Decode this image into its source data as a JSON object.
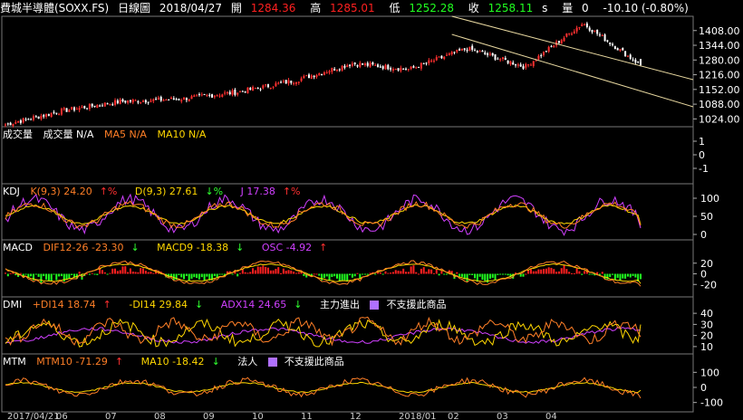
{
  "header": {
    "title": "費城半導體(SOXX.FS)",
    "period": "日線圖",
    "date": "2018/04/27",
    "open_label": "開",
    "open": "1284.36",
    "high_label": "高",
    "high": "1285.01",
    "low_label": "低",
    "low": "1252.28",
    "close_label": "收",
    "close": "1258.11",
    "unit": "s",
    "vol_label": "量",
    "vol": "0",
    "change": "-10.10 (-0.80%)"
  },
  "panes": {
    "price": {
      "ticks": [
        "1408.00",
        "1344.00",
        "1280.00",
        "1216.00",
        "1152.00",
        "1088.00",
        "1024.00"
      ]
    },
    "volume": {
      "label": "成交量",
      "vol": "成交量 N/A",
      "ma5": "MA5 N/A",
      "ma10": "MA10 N/A",
      "ticks": [
        "1",
        "0",
        "-1"
      ]
    },
    "kdj": {
      "label": "KDJ",
      "k": "K(9,3) 24.20",
      "k_arrow": "↑%",
      "d": "D(9,3) 27.61",
      "d_arrow": "↓%",
      "j": "J 17.38",
      "j_arrow": "↑%",
      "ticks": [
        "100",
        "50",
        "0"
      ]
    },
    "macd": {
      "label": "MACD",
      "dif": "DIF12-26 -23.30",
      "dif_arrow": "↓",
      "macd9": "MACD9 -18.38",
      "macd9_arrow": "↓",
      "osc": "OSC -4.92",
      "osc_arrow": "↑",
      "ticks": [
        "20",
        "0",
        "-20"
      ]
    },
    "dmi": {
      "label": "DMI",
      "pdi": "+DI14 18.74",
      "pdi_arrow": "↑",
      "mdi": "-DI14 29.84",
      "mdi_arrow": "↓",
      "adx": "ADX14 24.65",
      "adx_arrow": "↓",
      "main": "主力進出",
      "unsupported": "不支援此商品",
      "ticks": [
        "40",
        "30",
        "20",
        "10"
      ]
    },
    "mtm": {
      "label": "MTM",
      "mtm": "MTM10 -71.29",
      "mtm_arrow": "↑",
      "ma": "MA10 -18.42",
      "ma_arrow": "↓",
      "inst": "法人",
      "unsupported": "不支援此商品",
      "ticks": [
        "100",
        "0",
        "-100"
      ]
    }
  },
  "xaxis": {
    "ticks": [
      "2017/04/21",
      "06",
      "07",
      "08",
      "09",
      "10",
      "11",
      "12",
      "2018/01",
      "02",
      "03",
      "04"
    ]
  },
  "colors": {
    "up": "#ff2020",
    "down": "#20ff20",
    "bg": "#000000",
    "grid": "#555555",
    "k": "#ff7f27",
    "d": "#ffd700",
    "j": "#d040ff",
    "dif": "#ff7f27",
    "macd9": "#ffd700",
    "pdi": "#ff7f27",
    "mdi": "#ffd700",
    "adx": "#d040ff"
  },
  "chart_data": [
    {
      "type": "candlestick",
      "title": "費城半導體(SOXX.FS)",
      "ylim": [
        990,
        1470
      ],
      "x": [
        "2017/04/21",
        "06",
        "07",
        "08",
        "09",
        "10",
        "11",
        "12",
        "2018/01",
        "02",
        "03",
        "04"
      ],
      "close_anchors": [
        1000,
        1060,
        1100,
        1110,
        1140,
        1190,
        1265,
        1240,
        1330,
        1250,
        1440,
        1258.11
      ],
      "last": {
        "date": "2018/04/27",
        "open": 1284.36,
        "high": 1285.01,
        "low": 1252.28,
        "close": 1258.11
      }
    },
    {
      "type": "line",
      "title": "KDJ",
      "ylim": [
        -10,
        110
      ],
      "series": [
        {
          "name": "K(9,3)",
          "last": 24.2
        },
        {
          "name": "D(9,3)",
          "last": 27.61
        },
        {
          "name": "J",
          "last": 17.38
        }
      ]
    },
    {
      "type": "bar",
      "title": "MACD",
      "ylim": [
        -40,
        40
      ],
      "series": [
        {
          "name": "DIF12-26",
          "last": -23.3
        },
        {
          "name": "MACD9",
          "last": -18.38
        },
        {
          "name": "OSC",
          "last": -4.92
        }
      ]
    },
    {
      "type": "line",
      "title": "DMI",
      "ylim": [
        5,
        45
      ],
      "series": [
        {
          "name": "+DI14",
          "last": 18.74
        },
        {
          "name": "-DI14",
          "last": 29.84
        },
        {
          "name": "ADX14",
          "last": 24.65
        }
      ]
    },
    {
      "type": "line",
      "title": "MTM",
      "ylim": [
        -150,
        150
      ],
      "series": [
        {
          "name": "MTM10",
          "last": -71.29
        },
        {
          "name": "MA10",
          "last": -18.42
        }
      ]
    }
  ]
}
